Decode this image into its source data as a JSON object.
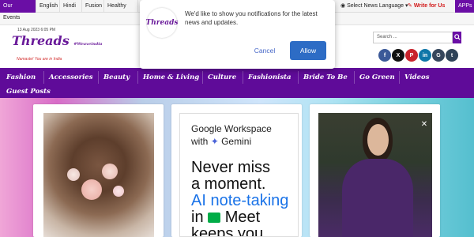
{
  "topbar": {
    "tabs": [
      "Our Domains",
      "English",
      "Hindi",
      "Fusion",
      "Healthy Life"
    ],
    "events": "Events",
    "select_news_language": "Select News Language",
    "write_for_us": "Write for Us",
    "apps": "APPs"
  },
  "header": {
    "date": "13 Aug 2023 6:05 PM",
    "logo_main": "Threads",
    "logo_suffix": "#Weaveindia",
    "tagline": "Namaste! You are in India",
    "search_placeholder": "Search ...",
    "social": [
      "f",
      "X",
      "P",
      "in",
      "G",
      "t"
    ]
  },
  "nav": {
    "row1": [
      "Fashion",
      "Accessories",
      "Beauty",
      "Home & Living",
      "Culture",
      "Fashionista",
      "Bride To Be",
      "Go Green",
      "Videos"
    ],
    "row2": [
      "Guest Posts"
    ]
  },
  "popup": {
    "logo": "Threads",
    "message": "We'd like to show you notifications for the latest news and updates.",
    "cancel": "Cancel",
    "allow": "Allow"
  },
  "ad": {
    "line1": "Google Workspace",
    "line2_prefix": "with",
    "line2_brand": "Gemini",
    "line3": "Never miss",
    "line4": "a moment.",
    "line5": "AI note-taking",
    "line6": "in",
    "line6_brand": "Meet",
    "line7": "keeps you"
  },
  "colors": {
    "brand_purple": "#6a0ea5",
    "nav_purple": "#5f0b99",
    "allow_blue": "#2d6cc5",
    "cancel_blue": "#4566c7",
    "accent_red": "#d21919"
  },
  "icons": {
    "search": "search-icon",
    "close": "close-icon",
    "globe": "globe-icon",
    "pen": "pen-icon",
    "gemini": "gemini-sparkle-icon",
    "meet": "meet-icon"
  }
}
